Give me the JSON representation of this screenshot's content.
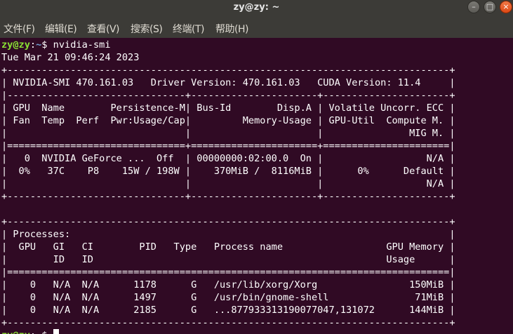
{
  "window": {
    "title": "zy@zy: ~",
    "buttons": {
      "minimize": "–",
      "maximize": "□",
      "close": "×"
    }
  },
  "menu": [
    {
      "label": "文件(F)"
    },
    {
      "label": "编辑(E)"
    },
    {
      "label": "查看(V)"
    },
    {
      "label": "搜索(S)"
    },
    {
      "label": "终端(T)"
    },
    {
      "label": "帮助(H)"
    }
  ],
  "terminal": {
    "prompt_user": "zy@zy",
    "prompt_path": "~",
    "prompt_symbol": "$ ",
    "command": "nvidia-smi",
    "lines": [
      "Tue Mar 21 09:46:24 2023",
      "+-----------------------------------------------------------------------------+",
      "| NVIDIA-SMI 470.161.03   Driver Version: 470.161.03   CUDA Version: 11.4     |",
      "|-------------------------------+----------------------+----------------------+",
      "| GPU  Name        Persistence-M| Bus-Id        Disp.A | Volatile Uncorr. ECC |",
      "| Fan  Temp  Perf  Pwr:Usage/Cap|         Memory-Usage | GPU-Util  Compute M. |",
      "|                               |                      |               MIG M. |",
      "|===============================+======================+======================|",
      "|   0  NVIDIA GeForce ...  Off  | 00000000:02:00.0  On |                  N/A |",
      "|  0%   37C    P8    15W / 198W |    370MiB /  8116MiB |      0%      Default |",
      "|                               |                      |                  N/A |",
      "+-------------------------------+----------------------+----------------------+",
      "",
      "+-----------------------------------------------------------------------------+",
      "| Processes:                                                                  |",
      "|  GPU   GI   CI        PID   Type   Process name                  GPU Memory |",
      "|        ID   ID                                                   Usage      |",
      "|=============================================================================|",
      "|    0   N/A  N/A      1178      G   /usr/lib/xorg/Xorg                150MiB |",
      "|    0   N/A  N/A      1497      G   /usr/bin/gnome-shell               71MiB |",
      "|    0   N/A  N/A      2185      G   ...877933313190077047,131072      144MiB |",
      "+-----------------------------------------------------------------------------+"
    ]
  }
}
